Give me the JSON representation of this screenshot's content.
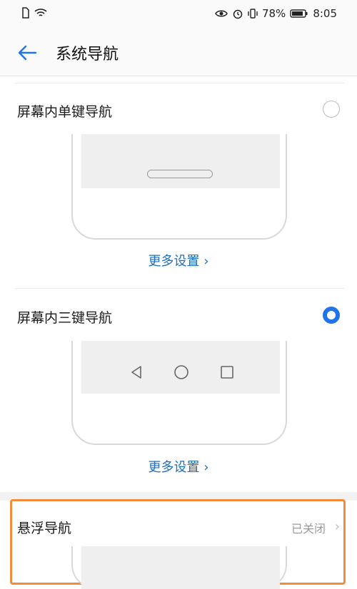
{
  "status_bar": {
    "battery": "78%",
    "time": "8:05"
  },
  "header": {
    "title": "系统导航"
  },
  "options": [
    {
      "label": "屏幕内单键导航",
      "more": "更多设置 ›",
      "selected": false
    },
    {
      "label": "屏幕内三键导航",
      "more": "更多设置 ›",
      "selected": true
    },
    {
      "label": "悬浮导航",
      "status": "已关闭",
      "selected": false
    }
  ],
  "colors": {
    "accent": "#1e74e8",
    "link": "#1e6fbf",
    "highlight": "#f08c3c"
  },
  "icons": [
    "back-arrow-icon",
    "sim-card-icon",
    "wifi-icon",
    "eye-icon",
    "alarm-icon",
    "vibrate-icon",
    "battery-icon",
    "nav-back-icon",
    "nav-home-icon",
    "nav-recent-icon"
  ]
}
